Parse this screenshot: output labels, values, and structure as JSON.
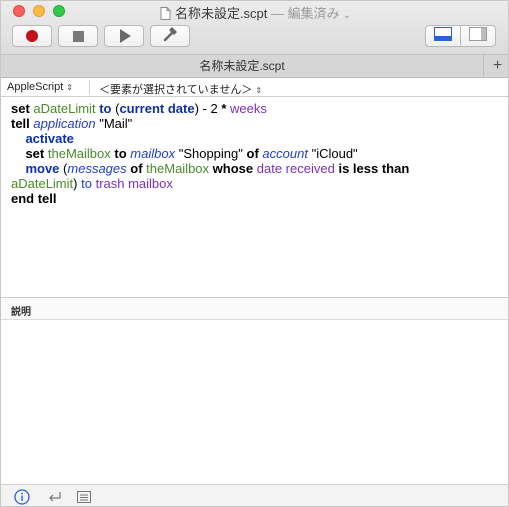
{
  "window": {
    "title": "名称未設定.scpt",
    "title_suffix": "— 編集済み",
    "edited_menu_icon": "chevron-down-icon"
  },
  "toolbar": {
    "record_icon": "record-icon",
    "stop_icon": "stop-icon",
    "run_icon": "play-icon",
    "compile_icon": "hammer-icon",
    "view_bottom_icon": "bottom-pane-icon",
    "view_side_icon": "side-pane-icon"
  },
  "tabs": [
    {
      "label": "名称未設定.scpt"
    }
  ],
  "tab_add_label": "+",
  "navbar": {
    "language": "AppleScript",
    "element": "＜要素が選択されていません＞"
  },
  "script": {
    "line1": {
      "w1": "set",
      "w2": "aDateLimit",
      "w3": "to",
      "w4": "(",
      "w5": "current date",
      "w6": ") - 2",
      "w7": "*",
      "w8": "weeks"
    },
    "line2": {
      "w1": "tell",
      "w2": "application",
      "w3": "\"Mail\""
    },
    "line3": {
      "w1": "activate"
    },
    "line4": {
      "w1": "set",
      "w2": "theMailbox",
      "w3": "to",
      "w4": "mailbox",
      "w5": "\"Shopping\"",
      "w6": "of",
      "w7": "account",
      "w8": "\"iCloud\""
    },
    "line5": {
      "w1": "move",
      "w2": "(",
      "w3": "messages",
      "w4": "of",
      "w5": "theMailbox",
      "w6": "whose",
      "w7": "date received",
      "w8": "is less than"
    },
    "line6": {
      "w1": "aDateLimit",
      "w2": ")",
      "w3": "to",
      "w4": "trash mailbox"
    },
    "line7": {
      "w1": "end tell"
    }
  },
  "description_panel": {
    "label": "説明"
  },
  "bottom_bar": {
    "info_icon": "info-icon",
    "return_icon": "return-icon",
    "list_icon": "list-icon"
  },
  "colors": {
    "keyword_blue": "#0b2fb0",
    "variable_green": "#4a8a2a",
    "property_purple": "#7a2fbf",
    "class_blue": "#1e3fd0",
    "record_red": "#c1121b"
  }
}
